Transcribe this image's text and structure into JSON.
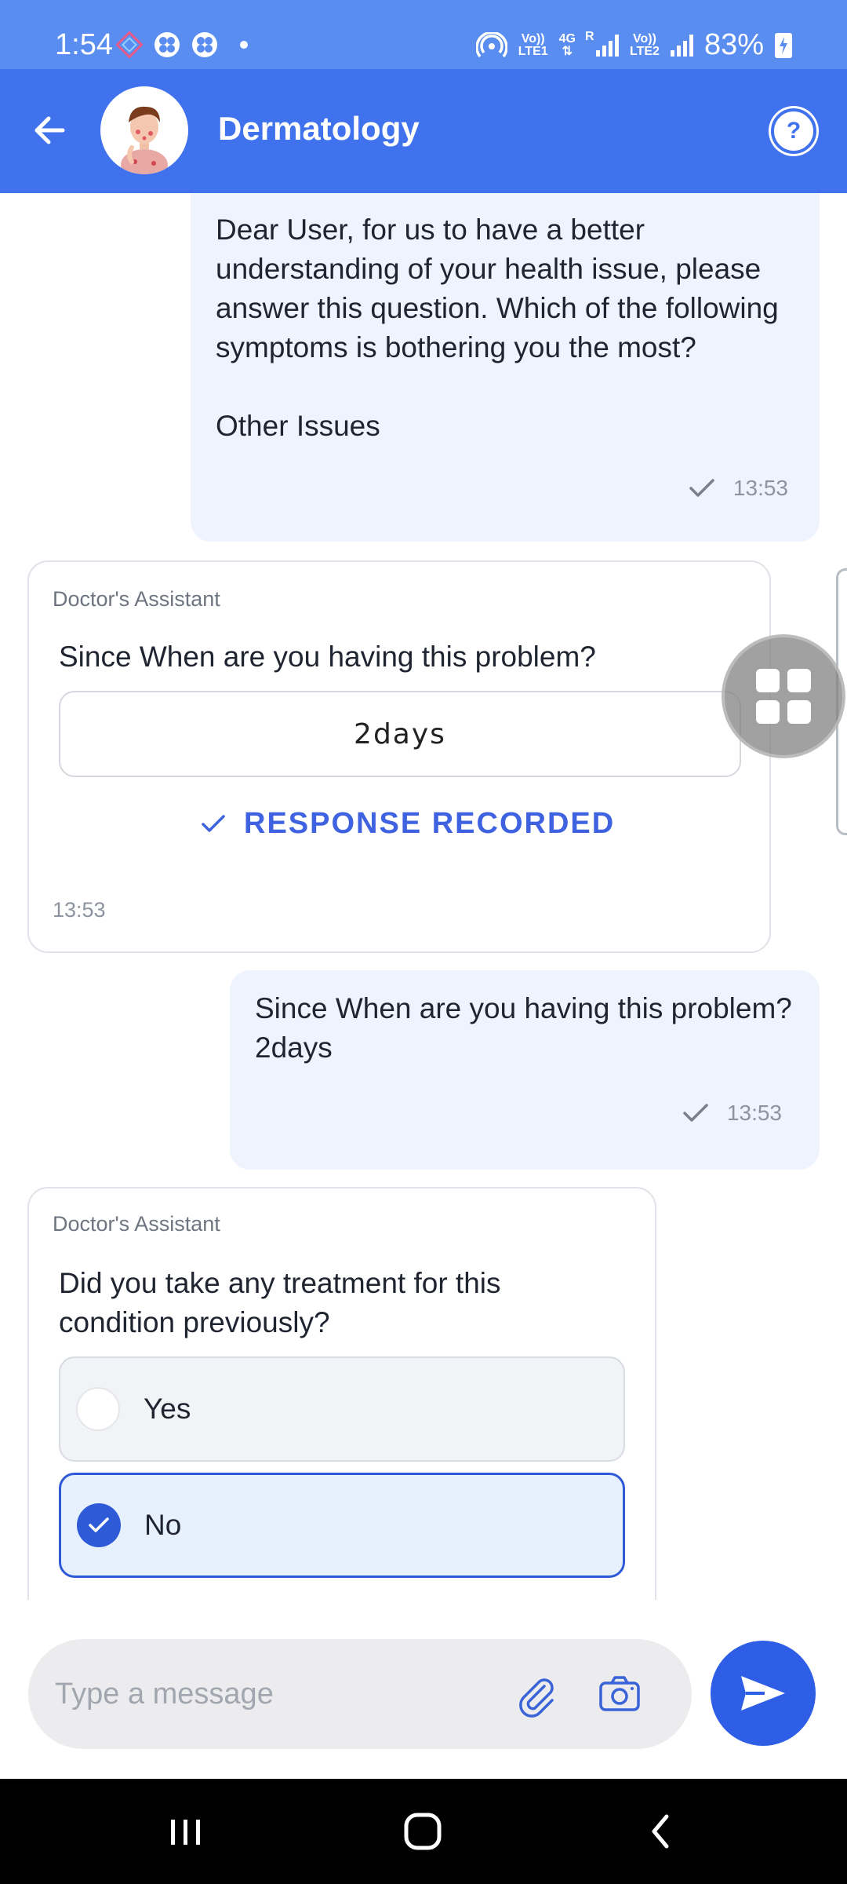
{
  "status_bar": {
    "time": "1:54",
    "net1_top": "Vo))",
    "net1_bottom": "LTE1",
    "net_4g": "4G",
    "net_r": "R",
    "net2_top": "Vo))",
    "net2_bottom": "LTE2",
    "battery": "83%"
  },
  "header": {
    "title": "Dermatology",
    "help_label": "?"
  },
  "messages": {
    "m1": {
      "text_line1": "Dear User, for us to have a better",
      "text_line2": "understanding of your health issue, please",
      "text_line3": "answer this question. Which of the following",
      "text_line4": "symptoms is bothering you the most?",
      "text_line5": "Other Issues",
      "time": "13:53"
    },
    "c1": {
      "sender": "Doctor's Assistant",
      "question": "Since When are you having this problem?",
      "answer": "2days",
      "status": "RESPONSE RECORDED",
      "time": "13:53"
    },
    "m2": {
      "text_line1": "Since When are you having this problem?",
      "text_line2": "2days",
      "time": "13:53"
    },
    "c2": {
      "sender": "Doctor's Assistant",
      "question_line1": "Did you take any treatment for this",
      "question_line2": "condition previously?",
      "options": [
        {
          "label": "Yes",
          "selected": false
        },
        {
          "label": "No",
          "selected": true
        }
      ]
    }
  },
  "input": {
    "placeholder": "Type a message",
    "value": ""
  },
  "colors": {
    "status_bar": "#5a8df0",
    "header": "#3f72ec",
    "accent": "#2e5ad8",
    "user_bubble": "#eef3fd"
  },
  "icons": [
    "back-arrow-icon",
    "question-icon",
    "check-icon",
    "grid-icon",
    "paperclip-icon",
    "camera-icon",
    "send-icon",
    "recents-icon",
    "home-icon",
    "back-nav-icon"
  ]
}
